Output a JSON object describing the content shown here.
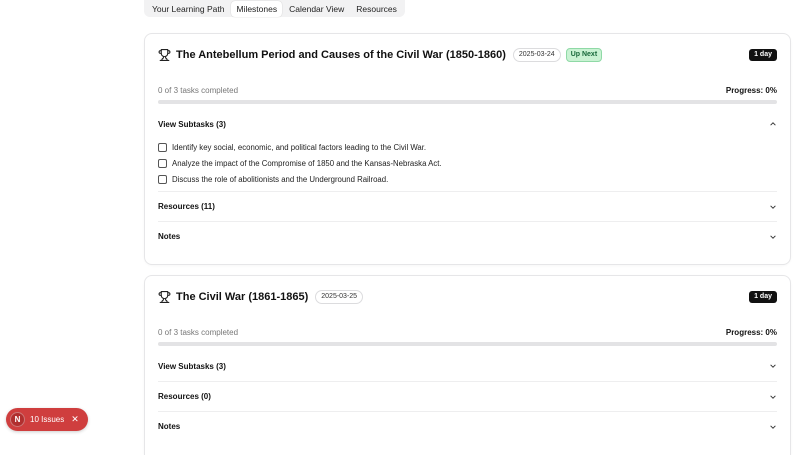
{
  "tabs": [
    {
      "label": "Your Learning Path"
    },
    {
      "label": "Milestones"
    },
    {
      "label": "Calendar View"
    },
    {
      "label": "Resources"
    }
  ],
  "milestones": [
    {
      "title": "The Antebellum Period and Causes of the Civil War (1850-1860)",
      "date": "2025-03-24",
      "status": "Up Next",
      "duration": "1 day",
      "tasks_completed": "0 of 3 tasks completed",
      "progress_label": "Progress: 0%",
      "progress": 0,
      "subtasks_label": "View Subtasks (3)",
      "subtasks": [
        "Identify key social, economic, and political factors leading to the Civil War.",
        "Analyze the impact of the Compromise of 1850 and the Kansas-Nebraska Act.",
        "Discuss the role of abolitionists and the Underground Railroad."
      ],
      "resources_label": "Resources (11)",
      "notes_label": "Notes"
    },
    {
      "title": "The Civil War (1861-1865)",
      "date": "2025-03-25",
      "duration": "1 day",
      "tasks_completed": "0 of 3 tasks completed",
      "progress_label": "Progress: 0%",
      "progress": 0,
      "subtasks_label": "View Subtasks (3)",
      "resources_label": "Resources (0)",
      "notes_label": "Notes"
    }
  ],
  "issues_badge": {
    "logo": "N",
    "label": "10 Issues",
    "close": "✕"
  },
  "colors": {
    "accent": "#111111",
    "up_next_bg": "#c9f2d3",
    "issues_bg": "#cf3e3e"
  }
}
